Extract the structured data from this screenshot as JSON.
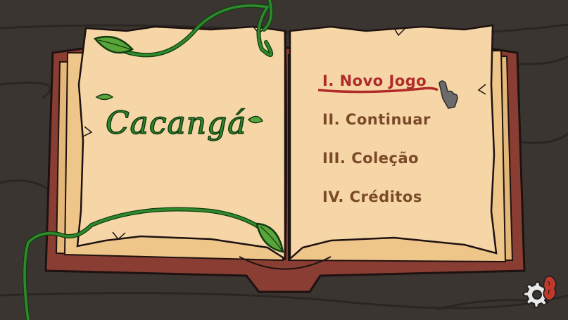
{
  "game": {
    "title": "Cacangá",
    "menu": [
      {
        "label": "I. Novo Jogo",
        "selected": true
      },
      {
        "label": "II. Continuar",
        "selected": false
      },
      {
        "label": "III. Coleção",
        "selected": false
      },
      {
        "label": "IV. Créditos",
        "selected": false
      }
    ]
  },
  "colors": {
    "background": "#3b3531",
    "page": "#f6d6a6",
    "cover": "#8a3e33",
    "menu_text": "#7a4a28",
    "menu_selected": "#b02a2a",
    "vine": "#2f8a2c"
  },
  "icons": {
    "settings": "gear-icon",
    "cursor": "hand-pointer-icon",
    "decoration": "brain-icon"
  }
}
